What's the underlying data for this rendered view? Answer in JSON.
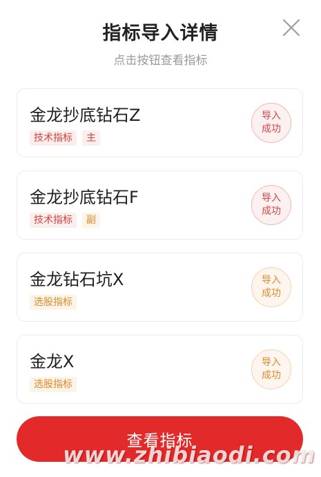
{
  "dialog": {
    "title": "指标导入详情",
    "subtitle": "点击按钮查看指标",
    "close_icon": "close-icon"
  },
  "cards": [
    {
      "name": "金龙抄底钻石Z",
      "tags": [
        {
          "label": "技术指标",
          "color": "red"
        },
        {
          "label": "主",
          "color": "red"
        }
      ],
      "status_line1": "导入",
      "status_line2": "成功",
      "status_color": "red"
    },
    {
      "name": "金龙抄底钻石F",
      "tags": [
        {
          "label": "技术指标",
          "color": "red"
        },
        {
          "label": "副",
          "color": "orange"
        }
      ],
      "status_line1": "导入",
      "status_line2": "成功",
      "status_color": "red"
    },
    {
      "name": "金龙钻石坑X",
      "tags": [
        {
          "label": "选股指标",
          "color": "orange"
        }
      ],
      "status_line1": "导入",
      "status_line2": "成功",
      "status_color": "orange"
    },
    {
      "name": "金龙X",
      "tags": [
        {
          "label": "选股指标",
          "color": "orange"
        }
      ],
      "status_line1": "导入",
      "status_line2": "成功",
      "status_color": "orange"
    }
  ],
  "primary_button": {
    "label": "查看指标"
  },
  "watermark": {
    "text": "www.zhibiaodi.com"
  },
  "colors": {
    "accent_red": "#e32a2a",
    "tag_red": "#d7403d",
    "tag_orange": "#e08a2c"
  }
}
